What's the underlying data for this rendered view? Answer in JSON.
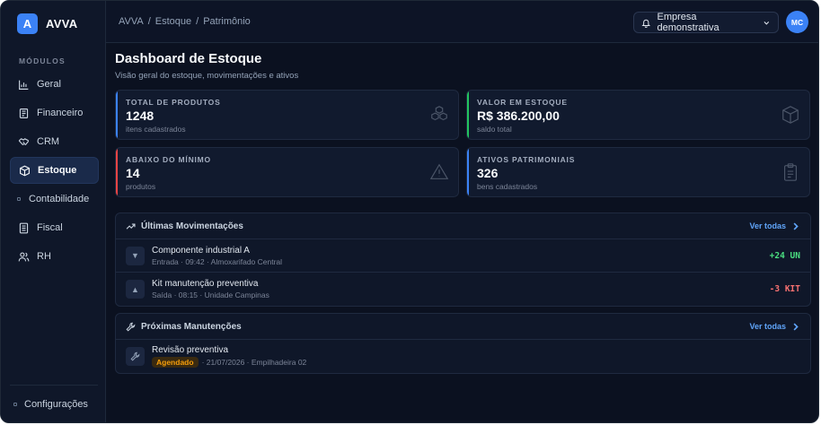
{
  "brand": {
    "logo_letter": "A",
    "name": "AVVA",
    "accent": "#3b82f6"
  },
  "sidebar": {
    "section_label": "MÓDULOS",
    "items": [
      {
        "label": "Geral",
        "icon": "bar-chart-icon"
      },
      {
        "label": "Financeiro",
        "icon": "receipt-icon"
      },
      {
        "label": "CRM",
        "icon": "handshake-icon"
      },
      {
        "label": "Estoque",
        "icon": "box-icon",
        "active": true
      },
      {
        "label": "Contabilidade",
        "icon": "dot-icon"
      },
      {
        "label": "Fiscal",
        "icon": "document-icon"
      },
      {
        "label": "RH",
        "icon": "users-icon"
      }
    ],
    "settings_label": "Configurações"
  },
  "header": {
    "breadcrumb": [
      "AVVA",
      "/",
      "Estoque",
      "/",
      "Patrimônio"
    ],
    "company_selector": "Empresa demonstrativa",
    "avatar_initials": "MC"
  },
  "page": {
    "title": "Dashboard de Estoque",
    "subtitle": "Visão geral do estoque, movimentações e ativos"
  },
  "cards": [
    {
      "label": "TOTAL DE PRODUTOS",
      "value": "1248",
      "foot": "itens cadastrados",
      "color": "#3b82f6",
      "icon": "cubes-icon"
    },
    {
      "label": "VALOR EM ESTOQUE",
      "value": "R$ 386.200,00",
      "foot": "saldo total",
      "color": "#22c55e",
      "icon": "package-icon"
    },
    {
      "label": "ABAIXO DO MÍNIMO",
      "value": "14",
      "foot": "produtos",
      "color": "#ef4444",
      "icon": "warning-icon"
    },
    {
      "label": "ATIVOS PATRIMONIAIS",
      "value": "326",
      "foot": "bens cadastrados",
      "color": "#3b82f6",
      "icon": "clipboard-icon"
    }
  ],
  "movements": {
    "title": "Últimas Movimentações",
    "see_all": "Ver todas",
    "rows": [
      {
        "arrow": "▼",
        "title": "Componente industrial A",
        "sub": "Entrada · 09:42 · Almoxarifado Central",
        "qty": "+24 UN"
      },
      {
        "arrow": "▲",
        "title": "Kit manutenção preventiva",
        "sub": "Saída · 08:15 · Unidade Campinas",
        "qty": "-3 KIT"
      }
    ]
  },
  "maintenance": {
    "title": "Próximas Manutenções",
    "see_all": "Ver todas",
    "rows": [
      {
        "title": "Revisão preventiva",
        "badge": "Agendado",
        "sub": "· 21/07/2026 · Empilhadeira 02"
      }
    ]
  }
}
